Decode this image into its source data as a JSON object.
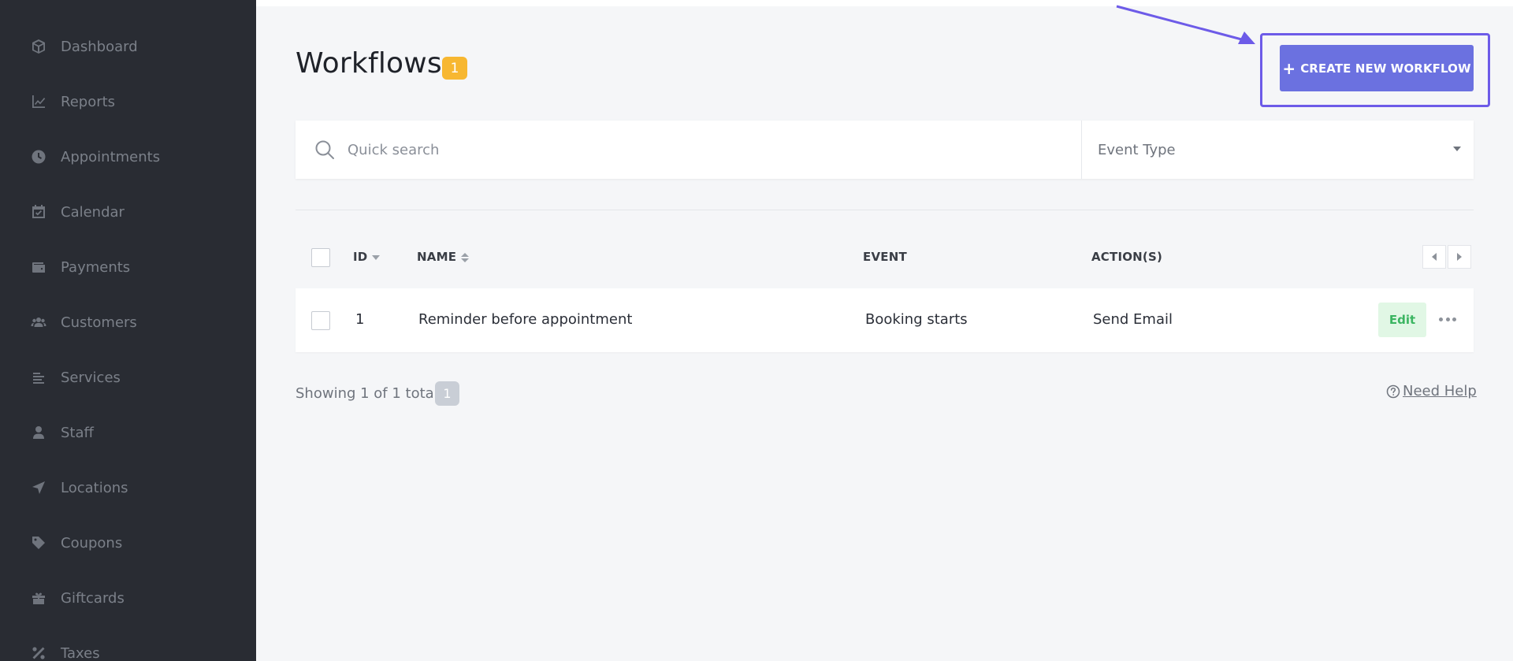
{
  "sidebar": {
    "items": [
      {
        "label": "Dashboard",
        "icon": "cube-icon"
      },
      {
        "label": "Reports",
        "icon": "chart-line-icon"
      },
      {
        "label": "Appointments",
        "icon": "clock-icon"
      },
      {
        "label": "Calendar",
        "icon": "calendar-check-icon"
      },
      {
        "label": "Payments",
        "icon": "wallet-icon"
      },
      {
        "label": "Customers",
        "icon": "users-icon"
      },
      {
        "label": "Services",
        "icon": "list-icon"
      },
      {
        "label": "Staff",
        "icon": "user-icon"
      },
      {
        "label": "Locations",
        "icon": "location-arrow-icon"
      },
      {
        "label": "Coupons",
        "icon": "tag-icon"
      },
      {
        "label": "Giftcards",
        "icon": "gift-icon"
      },
      {
        "label": "Taxes",
        "icon": "percent-icon"
      }
    ]
  },
  "header": {
    "title": "Workflows",
    "count": "1",
    "create_button": "CREATE NEW WORKFLOW"
  },
  "filters": {
    "search_placeholder": "Quick search",
    "event_type_placeholder": "Event Type"
  },
  "table": {
    "columns": {
      "id": "ID",
      "name": "NAME",
      "event": "EVENT",
      "actions": "ACTION(S)"
    },
    "rows": [
      {
        "id": "1",
        "name": "Reminder before appointment",
        "event": "Booking starts",
        "actions": "Send Email",
        "edit_label": "Edit"
      }
    ]
  },
  "footer": {
    "showing": "Showing 1 of 1 total",
    "page": "1",
    "help": "Need Help"
  },
  "colors": {
    "sidebar_bg": "#292c33",
    "accent": "#6b71e0",
    "highlight": "#6d5be8",
    "badge": "#f7b731",
    "edit_bg": "#e1f7e5",
    "edit_text": "#3bb561"
  }
}
